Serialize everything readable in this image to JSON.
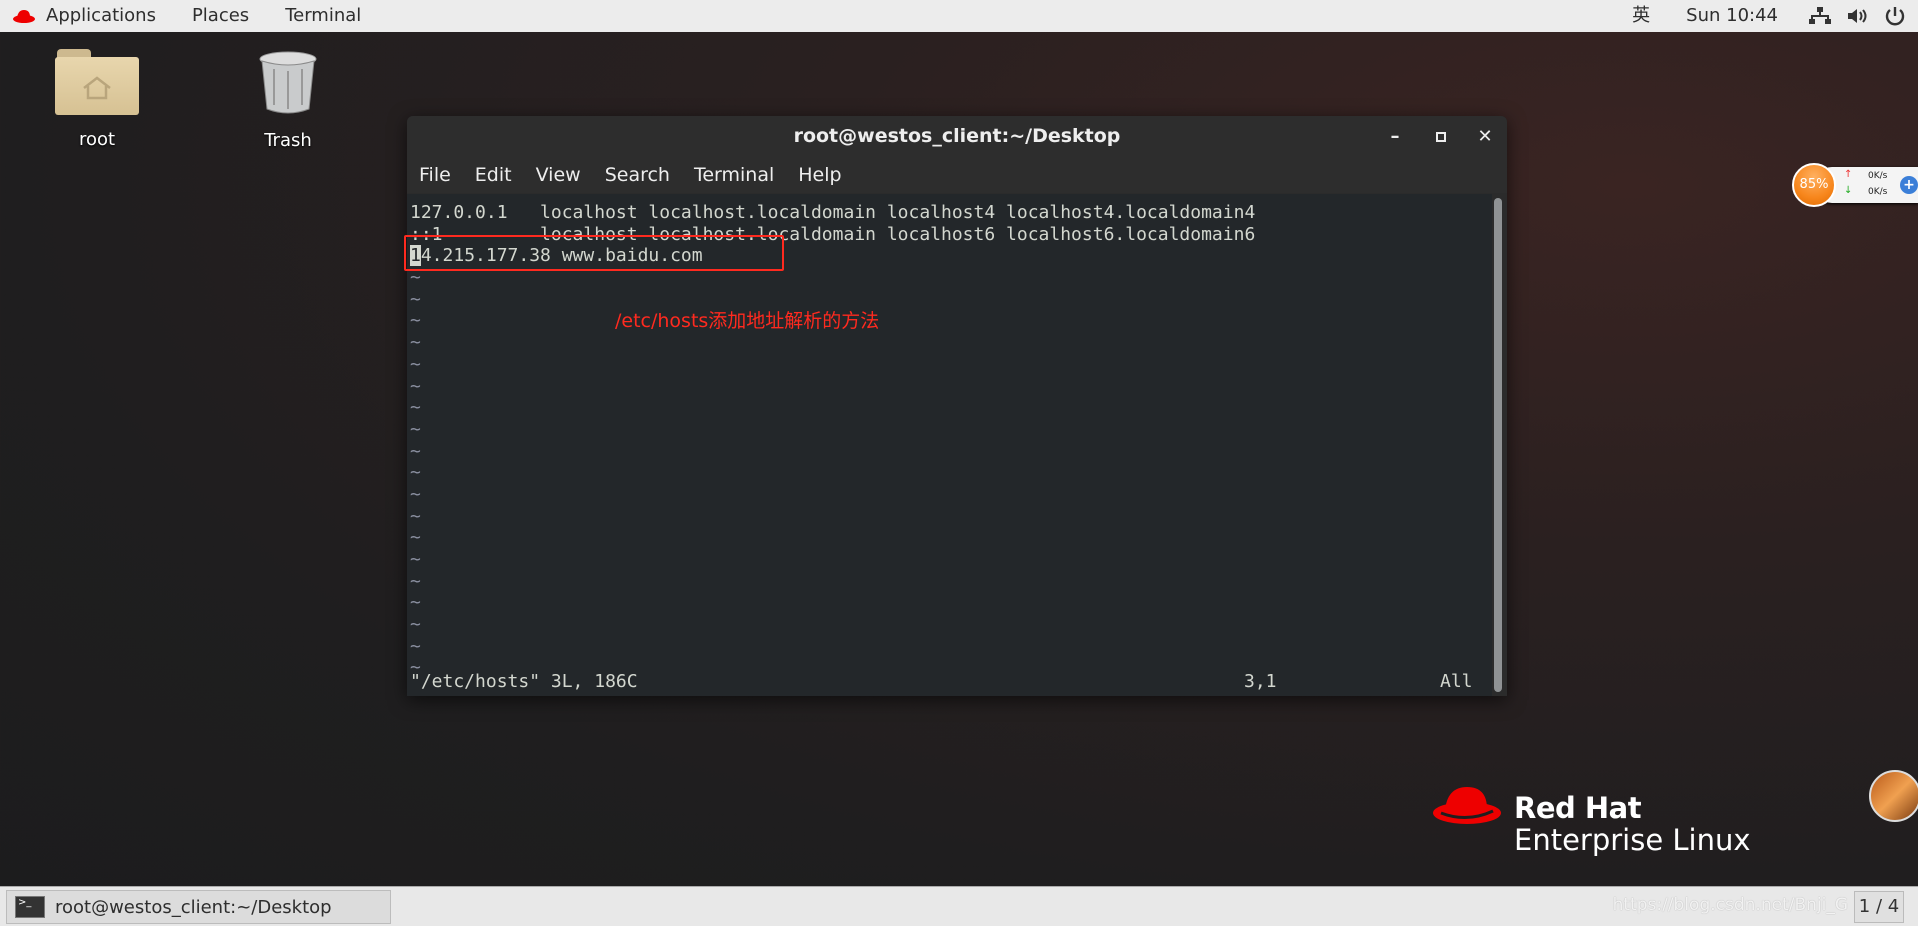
{
  "topbar": {
    "menus": [
      "Applications",
      "Places",
      "Terminal"
    ],
    "input_method": "英",
    "clock": "Sun 10:44"
  },
  "desktop": {
    "icons": [
      {
        "label": "root",
        "icon": "home-folder-icon"
      },
      {
        "label": "Trash",
        "icon": "trash-icon"
      }
    ]
  },
  "window": {
    "title": "root@westos_client:~/Desktop",
    "menu": [
      "File",
      "Edit",
      "View",
      "Search",
      "Terminal",
      "Help"
    ],
    "lines": [
      "127.0.0.1   localhost localhost.localdomain localhost4 localhost4.localdomain4",
      "::1         localhost localhost.localdomain localhost6 localhost6.localdomain6"
    ],
    "cursor_char": "1",
    "edited_line_rest": "4.215.177.38 www.baidu.com",
    "tilde": "~",
    "tilde_count": 19,
    "status_file": "\"/etc/hosts\" 3L, 186C",
    "status_pos": "3,1",
    "status_scroll": "All"
  },
  "annotation": "/etc/hosts添加地址解析的方法",
  "netwidget": {
    "cpu": "85%",
    "up": "0K/s",
    "down": "0K/s"
  },
  "branding": {
    "line1": "Red Hat",
    "line2": "Enterprise Linux"
  },
  "taskbar": {
    "task": "root@westos_client:~/Desktop",
    "workspace": "1 / 4",
    "watermark": "https://blog.csdn.net/Bnji_G"
  },
  "colors": {
    "annotation": "#ff2a1f",
    "redhat": "#ee0000",
    "widget": "#f7861c"
  }
}
